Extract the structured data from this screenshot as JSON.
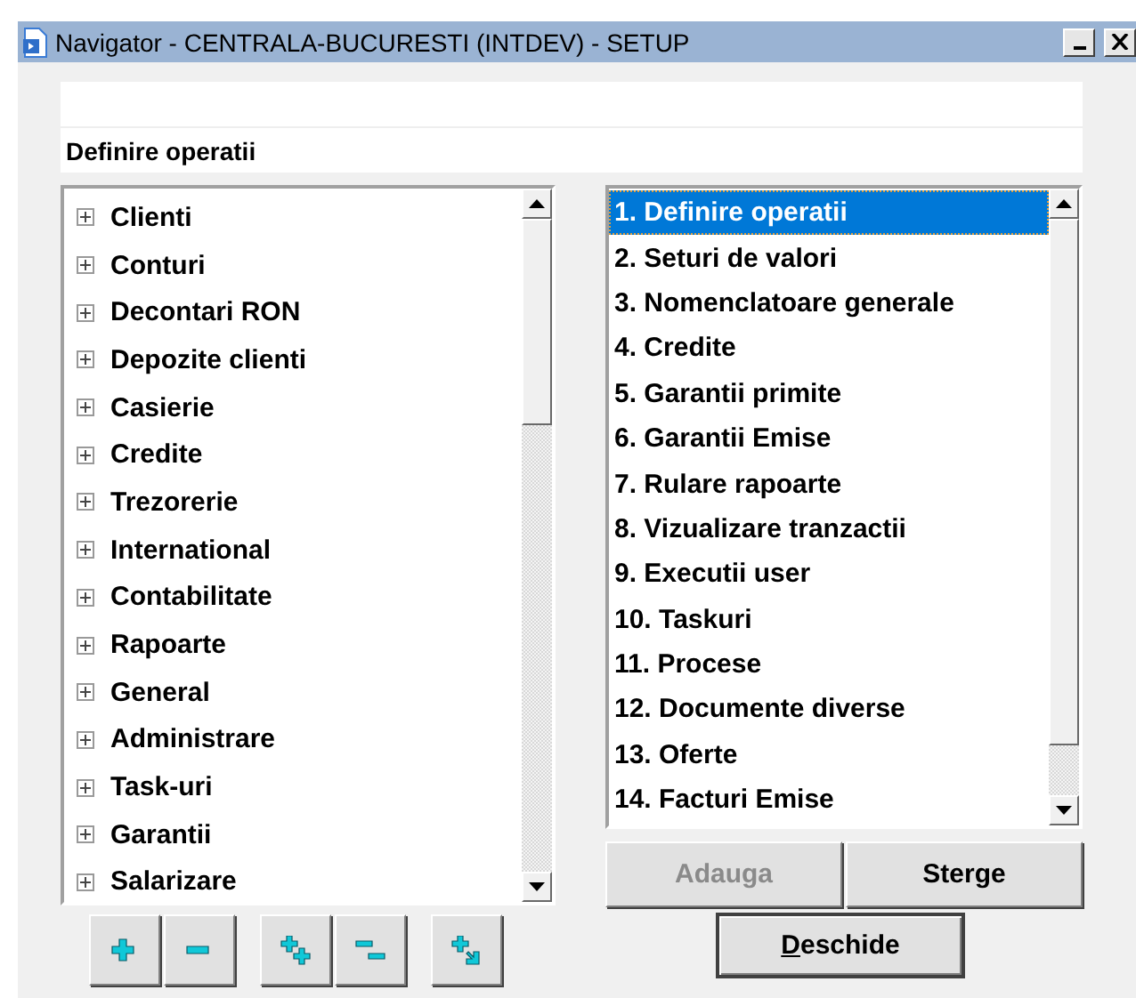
{
  "window": {
    "title": "Navigator - CENTRALA-BUCURESTI (INTDEV) - SETUP"
  },
  "section_title": "Definire operatii",
  "tree": {
    "items": [
      {
        "label": "Clienti",
        "expanded": false
      },
      {
        "label": "Conturi",
        "expanded": false
      },
      {
        "label": "Decontari RON",
        "expanded": false
      },
      {
        "label": "Depozite clienti",
        "expanded": false
      },
      {
        "label": "Casierie",
        "expanded": false
      },
      {
        "label": "Credite",
        "expanded": false
      },
      {
        "label": "Trezorerie",
        "expanded": false
      },
      {
        "label": "International",
        "expanded": false
      },
      {
        "label": "Contabilitate",
        "expanded": false
      },
      {
        "label": "Rapoarte",
        "expanded": false
      },
      {
        "label": "General",
        "expanded": false
      },
      {
        "label": "Administrare",
        "expanded": false
      },
      {
        "label": "Task-uri",
        "expanded": false
      },
      {
        "label": "Garantii",
        "expanded": false
      },
      {
        "label": "Salarizare",
        "expanded": false
      }
    ]
  },
  "toolbar": [
    [
      {
        "kind": "expand"
      },
      {
        "kind": "collapse"
      }
    ],
    [
      {
        "kind": "expand_all"
      },
      {
        "kind": "collapse_all"
      }
    ],
    [
      {
        "kind": "expand_to"
      }
    ]
  ],
  "operations": {
    "items": [
      {
        "label": "1. Definire operatii",
        "selected": true
      },
      {
        "label": "2. Seturi de valori",
        "selected": false
      },
      {
        "label": "3. Nomenclatoare generale",
        "selected": false
      },
      {
        "label": "4. Credite",
        "selected": false
      },
      {
        "label": "5. Garantii primite",
        "selected": false
      },
      {
        "label": "6. Garantii Emise",
        "selected": false
      },
      {
        "label": "7. Rulare rapoarte",
        "selected": false
      },
      {
        "label": "8. Vizualizare tranzactii",
        "selected": false
      },
      {
        "label": "9. Executii user",
        "selected": false
      },
      {
        "label": "10. Taskuri",
        "selected": false
      },
      {
        "label": "11. Procese",
        "selected": false
      },
      {
        "label": "12. Documente diverse",
        "selected": false
      },
      {
        "label": "13. Oferte",
        "selected": false
      },
      {
        "label": "14. Facturi Emise",
        "selected": false
      }
    ]
  },
  "buttons": [
    {
      "label": "Adauga",
      "disabled": true
    },
    {
      "label": "Sterge",
      "disabled": false
    }
  ],
  "open_button": {
    "label": "Deschide"
  }
}
